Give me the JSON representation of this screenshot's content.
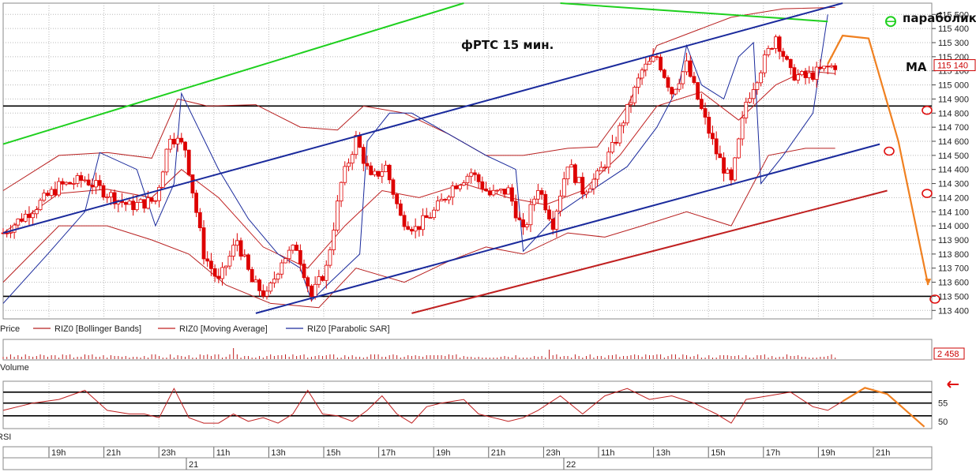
{
  "annotations": {
    "title": "фРТС   15 мин.",
    "parabolic_label": "параболик",
    "ma_label": "МА"
  },
  "legend": [
    "Price",
    "RIZ0 [Bollinger Bands]",
    "RIZ0 [Moving Average]",
    "RIZ0 [Parabolic SAR]"
  ],
  "colors": {
    "candle": "#dd0000",
    "bollinger": "#b82020",
    "ma": "#c02020",
    "sar": "#1a2a9c",
    "channel": "#1a2a9c",
    "green_trend": "#1ed01e",
    "red_trend": "#c02020",
    "forecast": "#f08020",
    "grid": "#b8b8b8"
  },
  "chart_data": [
    {
      "type": "candlestick",
      "title": "фРТС   15 мин.",
      "ylim": [
        113340,
        115580
      ],
      "y_ticks": [
        "115 500",
        "115 400",
        "115 300",
        "115 200",
        "115 100",
        "115 000",
        "114 900",
        "114 800",
        "114 700",
        "114 600",
        "114 500",
        "114 400",
        "114 300",
        "114 200",
        "114 100",
        "114 000",
        "113 900",
        "113 800",
        "113 700",
        "113 600",
        "113 500",
        "113 400"
      ],
      "y_tick_values": [
        115500,
        115400,
        115300,
        115200,
        115100,
        115000,
        114900,
        114800,
        114700,
        114600,
        114500,
        114400,
        114300,
        114200,
        114100,
        114000,
        113900,
        113800,
        113700,
        113600,
        113500,
        113400
      ],
      "last_price": "115 140",
      "last_price_value": 115140,
      "horizontal_levels": [
        114850,
        113500
      ],
      "close_path": [
        {
          "x": 0,
          "y": 113950
        },
        {
          "x": 8,
          "y": 114120
        },
        {
          "x": 15,
          "y": 114280
        },
        {
          "x": 22,
          "y": 114330
        },
        {
          "x": 28,
          "y": 114230
        },
        {
          "x": 34,
          "y": 114140
        },
        {
          "x": 41,
          "y": 114180
        },
        {
          "x": 45,
          "y": 114650
        },
        {
          "x": 49,
          "y": 114550
        },
        {
          "x": 54,
          "y": 113800
        },
        {
          "x": 58,
          "y": 113600
        },
        {
          "x": 63,
          "y": 113900
        },
        {
          "x": 67,
          "y": 113600
        },
        {
          "x": 71,
          "y": 113500
        },
        {
          "x": 75,
          "y": 113760
        },
        {
          "x": 79,
          "y": 113850
        },
        {
          "x": 83,
          "y": 113500
        },
        {
          "x": 87,
          "y": 113700
        },
        {
          "x": 91,
          "y": 114300
        },
        {
          "x": 95,
          "y": 114620
        },
        {
          "x": 99,
          "y": 114330
        },
        {
          "x": 103,
          "y": 114420
        },
        {
          "x": 107,
          "y": 114060
        },
        {
          "x": 111,
          "y": 113980
        },
        {
          "x": 116,
          "y": 114100
        },
        {
          "x": 121,
          "y": 114280
        },
        {
          "x": 126,
          "y": 114380
        },
        {
          "x": 131,
          "y": 114220
        },
        {
          "x": 136,
          "y": 114250
        },
        {
          "x": 140,
          "y": 113950
        },
        {
          "x": 144,
          "y": 114280
        },
        {
          "x": 148,
          "y": 114020
        },
        {
          "x": 152,
          "y": 114450
        },
        {
          "x": 156,
          "y": 114250
        },
        {
          "x": 160,
          "y": 114350
        },
        {
          "x": 164,
          "y": 114550
        },
        {
          "x": 168,
          "y": 114820
        },
        {
          "x": 172,
          "y": 115100
        },
        {
          "x": 176,
          "y": 115200
        },
        {
          "x": 180,
          "y": 114950
        },
        {
          "x": 184,
          "y": 115140
        },
        {
          "x": 188,
          "y": 114820
        },
        {
          "x": 192,
          "y": 114520
        },
        {
          "x": 196,
          "y": 114300
        },
        {
          "x": 200,
          "y": 114880
        },
        {
          "x": 204,
          "y": 115120
        },
        {
          "x": 208,
          "y": 115350
        },
        {
          "x": 212,
          "y": 115080
        },
        {
          "x": 216,
          "y": 115050
        },
        {
          "x": 220,
          "y": 115100
        },
        {
          "x": 224,
          "y": 115140
        }
      ],
      "bollinger_upper_path": [
        {
          "x": 0,
          "y": 114250
        },
        {
          "x": 15,
          "y": 114500
        },
        {
          "x": 28,
          "y": 114520
        },
        {
          "x": 40,
          "y": 114480
        },
        {
          "x": 47,
          "y": 114900
        },
        {
          "x": 55,
          "y": 114850
        },
        {
          "x": 68,
          "y": 114860
        },
        {
          "x": 80,
          "y": 114700
        },
        {
          "x": 90,
          "y": 114680
        },
        {
          "x": 97,
          "y": 114850
        },
        {
          "x": 108,
          "y": 114800
        },
        {
          "x": 120,
          "y": 114650
        },
        {
          "x": 130,
          "y": 114500
        },
        {
          "x": 140,
          "y": 114500
        },
        {
          "x": 152,
          "y": 114550
        },
        {
          "x": 160,
          "y": 114560
        },
        {
          "x": 168,
          "y": 114850
        },
        {
          "x": 176,
          "y": 115280
        },
        {
          "x": 188,
          "y": 115400
        },
        {
          "x": 196,
          "y": 115480
        },
        {
          "x": 210,
          "y": 115540
        },
        {
          "x": 224,
          "y": 115550
        }
      ],
      "bollinger_lower_path": [
        {
          "x": 0,
          "y": 113600
        },
        {
          "x": 15,
          "y": 114000
        },
        {
          "x": 28,
          "y": 114000
        },
        {
          "x": 40,
          "y": 113900
        },
        {
          "x": 50,
          "y": 113800
        },
        {
          "x": 60,
          "y": 113580
        },
        {
          "x": 72,
          "y": 113450
        },
        {
          "x": 85,
          "y": 113420
        },
        {
          "x": 95,
          "y": 113700
        },
        {
          "x": 108,
          "y": 113600
        },
        {
          "x": 120,
          "y": 113750
        },
        {
          "x": 130,
          "y": 113850
        },
        {
          "x": 140,
          "y": 113800
        },
        {
          "x": 152,
          "y": 113950
        },
        {
          "x": 162,
          "y": 113920
        },
        {
          "x": 172,
          "y": 114000
        },
        {
          "x": 184,
          "y": 114100
        },
        {
          "x": 196,
          "y": 114000
        },
        {
          "x": 206,
          "y": 114500
        },
        {
          "x": 216,
          "y": 114550
        },
        {
          "x": 224,
          "y": 114550
        }
      ],
      "ma_path": [
        {
          "x": 0,
          "y": 113950
        },
        {
          "x": 15,
          "y": 114230
        },
        {
          "x": 28,
          "y": 114260
        },
        {
          "x": 40,
          "y": 114200
        },
        {
          "x": 48,
          "y": 114400
        },
        {
          "x": 58,
          "y": 114200
        },
        {
          "x": 70,
          "y": 113850
        },
        {
          "x": 82,
          "y": 113700
        },
        {
          "x": 92,
          "y": 114000
        },
        {
          "x": 102,
          "y": 114250
        },
        {
          "x": 112,
          "y": 114200
        },
        {
          "x": 124,
          "y": 114300
        },
        {
          "x": 136,
          "y": 114200
        },
        {
          "x": 146,
          "y": 114150
        },
        {
          "x": 156,
          "y": 114250
        },
        {
          "x": 166,
          "y": 114500
        },
        {
          "x": 176,
          "y": 114850
        },
        {
          "x": 188,
          "y": 114950
        },
        {
          "x": 198,
          "y": 114750
        },
        {
          "x": 208,
          "y": 115000
        },
        {
          "x": 216,
          "y": 115100
        },
        {
          "x": 224,
          "y": 115080
        }
      ],
      "sar_path": [
        {
          "x": 0,
          "y": 113450
        },
        {
          "x": 12,
          "y": 113800
        },
        {
          "x": 22,
          "y": 114100
        },
        {
          "x": 26,
          "y": 114520
        },
        {
          "x": 36,
          "y": 114400
        },
        {
          "x": 41,
          "y": 114000
        },
        {
          "x": 46,
          "y": 114300
        },
        {
          "x": 48,
          "y": 114940
        },
        {
          "x": 58,
          "y": 114400
        },
        {
          "x": 66,
          "y": 114050
        },
        {
          "x": 74,
          "y": 113800
        },
        {
          "x": 80,
          "y": 113700
        },
        {
          "x": 83,
          "y": 113470
        },
        {
          "x": 88,
          "y": 113600
        },
        {
          "x": 96,
          "y": 113800
        },
        {
          "x": 98,
          "y": 114600
        },
        {
          "x": 104,
          "y": 114800
        },
        {
          "x": 110,
          "y": 114800
        },
        {
          "x": 120,
          "y": 114650
        },
        {
          "x": 130,
          "y": 114500
        },
        {
          "x": 138,
          "y": 114400
        },
        {
          "x": 140,
          "y": 113820
        },
        {
          "x": 150,
          "y": 114100
        },
        {
          "x": 160,
          "y": 114280
        },
        {
          "x": 168,
          "y": 114420
        },
        {
          "x": 176,
          "y": 114700
        },
        {
          "x": 182,
          "y": 115000
        },
        {
          "x": 184,
          "y": 115280
        },
        {
          "x": 188,
          "y": 115000
        },
        {
          "x": 194,
          "y": 114900
        },
        {
          "x": 198,
          "y": 115200
        },
        {
          "x": 202,
          "y": 115300
        },
        {
          "x": 204,
          "y": 114300
        },
        {
          "x": 210,
          "y": 114500
        },
        {
          "x": 218,
          "y": 114800
        },
        {
          "x": 222,
          "y": 115500
        }
      ],
      "blue_channel_upper": [
        {
          "x": 0,
          "y": 113950
        },
        {
          "x": 226,
          "y": 115580
        }
      ],
      "blue_channel_lower": [
        {
          "x": 68,
          "y": 113380
        },
        {
          "x": 236,
          "y": 114580
        }
      ],
      "green_trend_upper": [
        {
          "x": 0,
          "y": 114580
        },
        {
          "x": 124,
          "y": 115580
        }
      ],
      "green_trend_lower": [
        {
          "x": 150,
          "y": 115580
        },
        {
          "x": 222,
          "y": 115450
        }
      ],
      "red_trend": [
        {
          "x": 110,
          "y": 113380
        },
        {
          "x": 238,
          "y": 114250
        }
      ],
      "forecast_path": [
        {
          "x": 222,
          "y": 115150
        },
        {
          "x": 226,
          "y": 115350
        },
        {
          "x": 233,
          "y": 115330
        },
        {
          "x": 241,
          "y": 114600
        },
        {
          "x": 249,
          "y": 113580
        }
      ],
      "marked_levels": [
        115450,
        114820,
        114530,
        114230,
        113480
      ]
    },
    {
      "type": "bar",
      "title": "Volume",
      "last_value": "2 458",
      "last_value_number": 2458,
      "note": "tick-size volume bars across the full time range"
    },
    {
      "type": "line",
      "title": "RSI",
      "ylim": [
        48,
        61
      ],
      "y_ticks": [
        "55",
        "50"
      ],
      "y_tick_values": [
        55,
        50
      ],
      "levels": [
        58,
        55,
        51.5
      ],
      "rsi_path": [
        {
          "x": 0,
          "y": 53
        },
        {
          "x": 8,
          "y": 55
        },
        {
          "x": 15,
          "y": 56
        },
        {
          "x": 22,
          "y": 58.5
        },
        {
          "x": 28,
          "y": 53
        },
        {
          "x": 34,
          "y": 52
        },
        {
          "x": 38,
          "y": 52
        },
        {
          "x": 42,
          "y": 51
        },
        {
          "x": 46,
          "y": 59
        },
        {
          "x": 50,
          "y": 51
        },
        {
          "x": 54,
          "y": 49.5
        },
        {
          "x": 58,
          "y": 49.5
        },
        {
          "x": 62,
          "y": 52
        },
        {
          "x": 66,
          "y": 50
        },
        {
          "x": 70,
          "y": 51
        },
        {
          "x": 74,
          "y": 49.5
        },
        {
          "x": 78,
          "y": 52
        },
        {
          "x": 82,
          "y": 58.5
        },
        {
          "x": 86,
          "y": 52
        },
        {
          "x": 90,
          "y": 51.5
        },
        {
          "x": 94,
          "y": 50
        },
        {
          "x": 98,
          "y": 53
        },
        {
          "x": 102,
          "y": 57
        },
        {
          "x": 106,
          "y": 52
        },
        {
          "x": 110,
          "y": 49.5
        },
        {
          "x": 114,
          "y": 54
        },
        {
          "x": 118,
          "y": 55
        },
        {
          "x": 124,
          "y": 56
        },
        {
          "x": 128,
          "y": 52
        },
        {
          "x": 132,
          "y": 51
        },
        {
          "x": 136,
          "y": 50
        },
        {
          "x": 140,
          "y": 51
        },
        {
          "x": 144,
          "y": 53
        },
        {
          "x": 150,
          "y": 57
        },
        {
          "x": 156,
          "y": 52
        },
        {
          "x": 162,
          "y": 57
        },
        {
          "x": 168,
          "y": 59
        },
        {
          "x": 174,
          "y": 56
        },
        {
          "x": 180,
          "y": 57
        },
        {
          "x": 186,
          "y": 55
        },
        {
          "x": 192,
          "y": 52
        },
        {
          "x": 196,
          "y": 49.5
        },
        {
          "x": 200,
          "y": 56
        },
        {
          "x": 206,
          "y": 57
        },
        {
          "x": 212,
          "y": 58
        },
        {
          "x": 218,
          "y": 54
        },
        {
          "x": 222,
          "y": 53
        },
        {
          "x": 226,
          "y": 55.5
        }
      ],
      "forecast_path": [
        {
          "x": 226,
          "y": 55.5
        },
        {
          "x": 232,
          "y": 59.2
        },
        {
          "x": 238,
          "y": 57.5
        },
        {
          "x": 248,
          "y": 48.5
        }
      ]
    }
  ],
  "time_axis": {
    "hour_labels": [
      "19h",
      "21h",
      "23h",
      "11h",
      "13h",
      "15h",
      "17h",
      "19h",
      "21h",
      "23h",
      "11h",
      "13h",
      "15h",
      "17h",
      "19h",
      "21h"
    ],
    "day_labels": [
      "21",
      "22"
    ]
  }
}
